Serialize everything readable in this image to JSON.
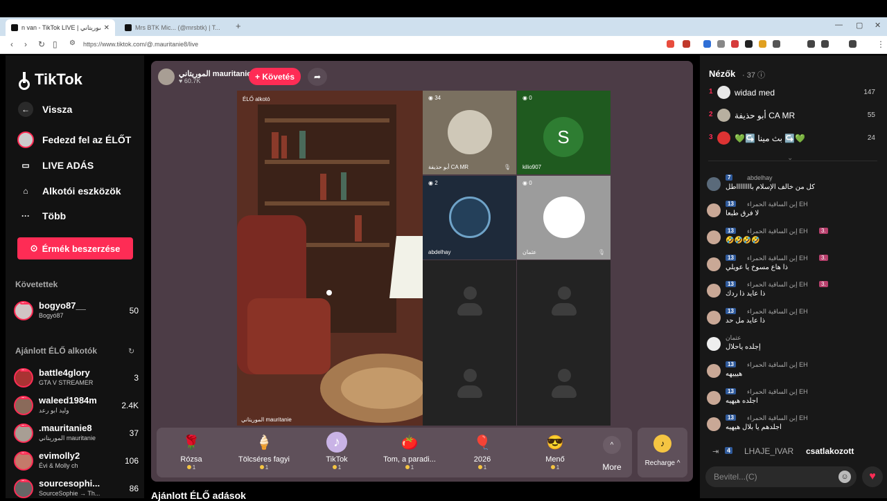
{
  "browser": {
    "tab_active_title": "n van - TikTok LIVE | الموريتاني",
    "tab_second_title": "Mrs BTK Mic... (@mrsbtk) | T...",
    "url": "https://www.tiktok.com/@.mauritanie8/live"
  },
  "sidebar": {
    "logo": "TikTok",
    "back": "Vissza",
    "nav": [
      "Fedezd fel az ÉLŐT",
      "LIVE ADÁS",
      "Alkotói eszközök",
      "Több"
    ],
    "coins_button": "Érmék beszerzése",
    "followed_title": "Követettek",
    "followed": [
      {
        "name": "bogyo87__",
        "sub": "Bogyó87",
        "count": "50"
      }
    ],
    "recommended_title": "Ajánlott ÉLŐ alkotók",
    "recommended": [
      {
        "name": "battle4glory",
        "sub": "GTA V STREAMER",
        "count": "3"
      },
      {
        "name": "waleed1984m",
        "sub": "وليد ابو رعد",
        "count": "2.4K"
      },
      {
        "name": ".mauritanie8",
        "sub": "الموريتاني mauritanie",
        "count": "37"
      },
      {
        "name": "evimolly2",
        "sub": "Évi & Molly ch",
        "count": "106"
      },
      {
        "name": "sourcesophi...",
        "sub": "SourceSophie → Th...",
        "count": "86"
      }
    ]
  },
  "stream": {
    "host_name": "الموريتاني mauritanie",
    "host_likes": "60.7K",
    "follow_label": "+ Követés",
    "video_label": "ÉLŐ alkotó",
    "video_owner": "الموريتاني mauritanie",
    "guests": [
      {
        "count": "34",
        "name": "أبو حذيفة CA MR",
        "muted": true
      },
      {
        "count": "0",
        "name": "kilio907",
        "letter": "S",
        "muted": false
      },
      {
        "count": "2",
        "name": "abdelhay",
        "muted": false
      },
      {
        "count": "0",
        "name": "عثمان",
        "muted": true
      }
    ]
  },
  "gifts": [
    {
      "label": "Rózsa",
      "price": "1",
      "icon": "🌹"
    },
    {
      "label": "Tölcséres fagyi",
      "price": "1",
      "icon": "🍦"
    },
    {
      "label": "TikTok",
      "price": "1",
      "icon": "♪"
    },
    {
      "label": "Tom, a paradi...",
      "price": "1",
      "icon": "🍅"
    },
    {
      "label": "2026",
      "price": "1",
      "icon": "🎈"
    },
    {
      "label": "Menő",
      "price": "1",
      "icon": "😎"
    }
  ],
  "gift_more": "More",
  "recharge": "Recharge ^",
  "recommended_streams": "Ajánlott ÉLŐ adások",
  "chat": {
    "viewers_title": "Nézők",
    "viewers_count": "· 37",
    "top_viewers": [
      {
        "rank": "1",
        "name": "widad med",
        "score": "147"
      },
      {
        "rank": "2",
        "name": "أبو حذيفة CA MR",
        "score": "55"
      },
      {
        "rank": "3",
        "name": "💚↪️ بث مينا ↪️💚",
        "score": "24"
      }
    ],
    "messages": [
      {
        "badge": "7",
        "user": "abdelhay",
        "text": "كل من خالف الإسلام بااااااااطل",
        "pill": ""
      },
      {
        "badge": "13",
        "user": "إبن الساقية الحمراء EH",
        "text": "لا فرق طبعا",
        "pill": ""
      },
      {
        "badge": "13",
        "user": "إبن الساقية الحمراء EH",
        "text": "🤣🤣🤣🤣",
        "pill": "3."
      },
      {
        "badge": "13",
        "user": "إبن الساقية الحمراء EH",
        "text": "ذا هاع مسوخ يا عويلي",
        "pill": "3."
      },
      {
        "badge": "13",
        "user": "إبن الساقية الحمراء EH",
        "text": "ذا عايد ذا ردك",
        "pill": "3."
      },
      {
        "badge": "13",
        "user": "إبن الساقية الحمراء EH",
        "text": "ذا عايد مل حد",
        "pill": ""
      },
      {
        "badge": "",
        "user": "عثمان",
        "text": "إجلده ياحلال",
        "pill": ""
      },
      {
        "badge": "13",
        "user": "إبن الساقية الحمراء EH",
        "text": "هيييهه",
        "pill": ""
      },
      {
        "badge": "13",
        "user": "إبن الساقية الحمراء EH",
        "text": "اجلده هيهيه",
        "pill": ""
      },
      {
        "badge": "13",
        "user": "إبن الساقية الحمراء EH",
        "text": "اجلدهم يا بلال هيهيه",
        "pill": ""
      }
    ],
    "join": {
      "badge": "4",
      "user": "LHAJE_IVAR",
      "text": "csatlakozott"
    },
    "input_placeholder": "Bevitel...(C)"
  },
  "colors": {
    "accent": "#fe2c55",
    "panel": "#4c3c46",
    "chat_bg": "#181818"
  }
}
